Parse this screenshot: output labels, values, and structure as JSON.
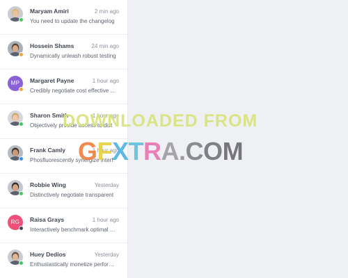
{
  "conversations": [
    {
      "name": "Maryam Amiri",
      "time": "2 min ago",
      "preview": "You need to update the changelog",
      "avatar": {
        "type": "photo",
        "skin": "#e8c3a3",
        "hair": "#d9b77b",
        "bg": "#c9ccd2"
      },
      "status_color": "#46c35f"
    },
    {
      "name": "Hossein Shams",
      "time": "24 min ago",
      "preview": "Dynamically unleash robust testing",
      "avatar": {
        "type": "photo",
        "skin": "#d7aa8a",
        "hair": "#5d4636",
        "bg": "#a9b0b8"
      },
      "status_color": "#f0a23c"
    },
    {
      "name": "Margaret Payne",
      "time": "1 hour ago",
      "preview": "Credibly negotiate cost effective a...",
      "avatar": {
        "type": "initials",
        "initials": "MP",
        "bg": "#8a62d6"
      },
      "status_color": "#f0a23c"
    },
    {
      "name": "Sharon Smith",
      "time": "1 hour ago",
      "preview": "Objectively provide access to dist",
      "avatar": {
        "type": "photo",
        "skin": "#edc7a8",
        "hair": "#cda66b",
        "bg": "#d5d8dc"
      },
      "status_color": "#46c35f"
    },
    {
      "name": "Frank Camly",
      "time": "1 hour ago",
      "preview": "Phosfluorescently synergize interf",
      "avatar": {
        "type": "photo",
        "skin": "#c99a78",
        "hair": "#3e3028",
        "bg": "#b7bcc3"
      },
      "status_color": "#3a8ee6"
    },
    {
      "name": "Robbie Wing",
      "time": "Yesterday",
      "preview": "Distinctively negotiate transparent",
      "avatar": {
        "type": "photo",
        "skin": "#d4a584",
        "hair": "#2c2a2a",
        "bg": "#c3c6cc"
      },
      "status_color": "#46c35f"
    },
    {
      "name": "Raisa Grays",
      "time": "1 hour ago",
      "preview": "Interactively benchmark optimal m...",
      "avatar": {
        "type": "initials",
        "initials": "RG",
        "bg": "#ef4f78"
      },
      "status_color": "#3f4450"
    },
    {
      "name": "Huey Dedios",
      "time": "Yesterday",
      "preview": "Enthusiastically monetize perform...",
      "avatar": {
        "type": "photo",
        "skin": "#e0b596",
        "hair": "#6a5446",
        "bg": "#c8ccd1"
      },
      "status_color": "#46c35f"
    }
  ],
  "watermark": {
    "line1": "DOWNLOADED FROM",
    "line2": "GFXTRA.COM",
    "line2_colors": [
      "#f07a3a",
      "#e7cf3a",
      "#4ab0e4",
      "#5ec0d8",
      "#ea6fae",
      "#9a9aa0",
      "#8d8d93",
      "#7d7d84",
      "#707077",
      "#66666d"
    ]
  }
}
